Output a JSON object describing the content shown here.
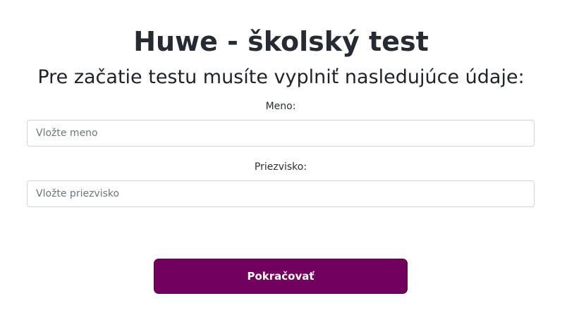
{
  "header": {
    "title": "Huwe - školský test",
    "subtitle": "Pre začatie testu musíte vyplniť nasledujúce údaje:"
  },
  "form": {
    "first_name": {
      "label": "Meno:",
      "value": "",
      "placeholder": "Vložte meno"
    },
    "last_name": {
      "label": "Priezvisko:",
      "value": "",
      "placeholder": "Vložte priezvisko"
    },
    "continue_label": "Pokračovať"
  },
  "colors": {
    "button_background": "#72005d",
    "button_text": "#ffffff",
    "input_border": "#ced4da",
    "title_text": "#262a33"
  }
}
